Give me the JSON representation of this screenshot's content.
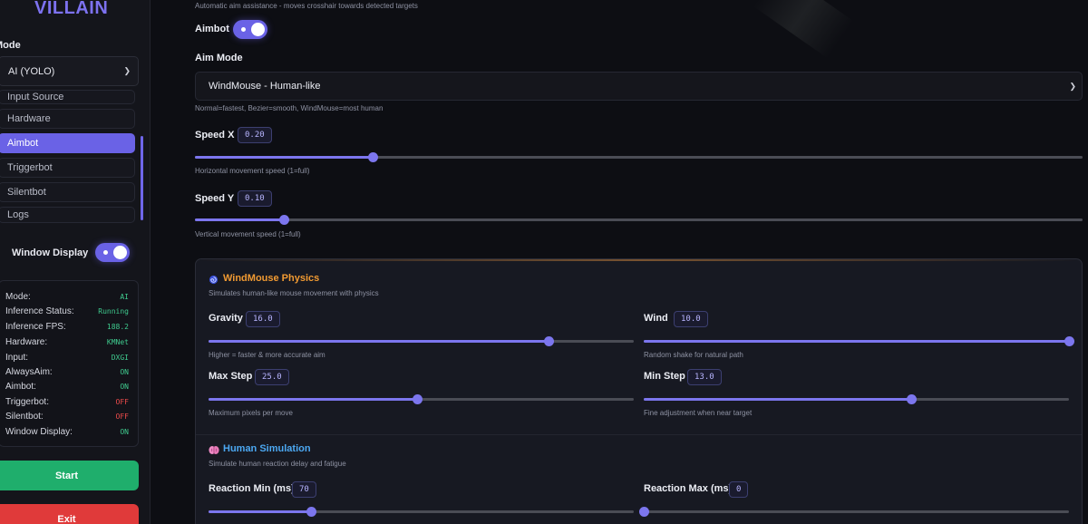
{
  "app": {
    "brand": "VILLAIN"
  },
  "sidebar": {
    "mode_label": "Mode",
    "mode_value": "AI (YOLO)",
    "nav": [
      {
        "label": "Input Source"
      },
      {
        "label": "Hardware"
      },
      {
        "label": "Aimbot"
      },
      {
        "label": "Triggerbot"
      },
      {
        "label": "Silentbot"
      },
      {
        "label": "Logs"
      }
    ],
    "window_display_label": "Window Display",
    "status": [
      {
        "label": "Mode:",
        "value": "AI"
      },
      {
        "label": "Inference Status:",
        "value": "Running"
      },
      {
        "label": "Inference FPS:",
        "value": "188.2"
      },
      {
        "label": "Hardware:",
        "value": "KMNet"
      },
      {
        "label": "Input:",
        "value": "DXGI"
      },
      {
        "label": "AlwaysAim:",
        "value": "ON"
      },
      {
        "label": "Aimbot:",
        "value": "ON"
      },
      {
        "label": "Triggerbot:",
        "value": "OFF"
      },
      {
        "label": "Silentbot:",
        "value": "OFF"
      },
      {
        "label": "Window Display:",
        "value": "ON"
      }
    ],
    "start_label": "Start",
    "exit_label": "Exit"
  },
  "main": {
    "intro_desc": "Automatic aim assistance - moves crosshair towards detected targets",
    "aimbot_label": "Aimbot",
    "aimbot_enabled": true,
    "aim_mode_label": "Aim Mode",
    "aim_mode_value": "WindMouse - Human-like",
    "aim_mode_hint": "Normal=fastest, Bezier=smooth, WindMouse=most human",
    "speed_x": {
      "label": "Speed X",
      "value": "0.20",
      "fraction": 0.2,
      "desc": "Horizontal movement speed (1=full)"
    },
    "speed_y": {
      "label": "Speed Y",
      "value": "0.10",
      "fraction": 0.1,
      "desc": "Vertical movement speed (1=full)"
    }
  },
  "windmouse": {
    "icon": "spiral-icon",
    "title": "WindMouse Physics",
    "subtitle": "Simulates human-like mouse movement with physics",
    "gravity": {
      "label": "Gravity",
      "value": "16.0",
      "fraction": 0.8,
      "desc": "Higher = faster & more accurate aim"
    },
    "wind": {
      "label": "Wind",
      "value": "10.0",
      "fraction": 1.0,
      "desc": "Random shake for natural path"
    },
    "max_step": {
      "label": "Max Step",
      "value": "25.0",
      "fraction": 0.49,
      "desc": "Maximum pixels per move"
    },
    "min_step": {
      "label": "Min Step",
      "value": "13.0",
      "fraction": 0.63,
      "desc": "Fine adjustment when near target"
    }
  },
  "human": {
    "icon": "brain-icon",
    "title": "Human Simulation",
    "subtitle": "Simulate human reaction delay and fatigue",
    "reaction_min": {
      "label": "Reaction Min (ms)",
      "value": "70",
      "fraction": 0.24
    },
    "reaction_max": {
      "label": "Reaction Max (ms)",
      "value": "0",
      "fraction": 0.0
    }
  },
  "colors": {
    "accent": "#6a62e6",
    "on": "#3fca8e",
    "off": "#ef4c4c",
    "orange": "#f19a32",
    "blue": "#4ca8f2",
    "start": "#1fae6c",
    "exit": "#e03a3a"
  }
}
